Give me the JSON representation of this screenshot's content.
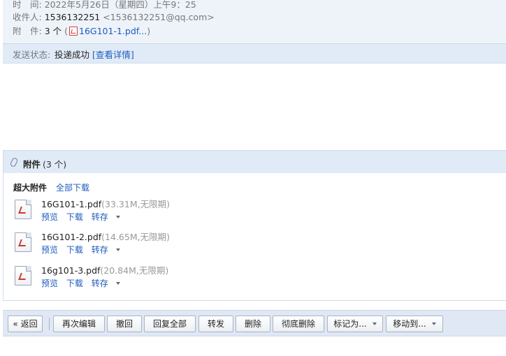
{
  "header": {
    "time_label": "时　间:",
    "time_value": "2022年5月26日（星期四）上午9：25",
    "recipient_label": "收件人:",
    "recipient_name": "1536132251",
    "recipient_email": "<1536132251@qq.com>",
    "attachment_label": "附　件:",
    "attachment_count": "3 个",
    "attachment_open": "(",
    "attachment_first": "16G101-1.pdf...",
    "attachment_close": ")"
  },
  "status": {
    "label": "发送状态:",
    "value": "投递成功",
    "detail_link": "[查看详情]"
  },
  "attachments": {
    "title": "附件",
    "count": "(3 个)",
    "super_label": "超大附件",
    "download_all": "全部下载",
    "files": [
      {
        "name": "16G101-1.pdf",
        "meta": "(33.31M,无限期)",
        "preview": "预览",
        "download": "下载",
        "save": "转存"
      },
      {
        "name": "16G101-2.pdf",
        "meta": "(14.65M,无限期)",
        "preview": "预览",
        "download": "下载",
        "save": "转存"
      },
      {
        "name": "16g101-3.pdf",
        "meta": "(20.84M,无限期)",
        "preview": "预览",
        "download": "下载",
        "save": "转存"
      }
    ]
  },
  "toolbar": {
    "back": "« 返回",
    "reedit": "再次编辑",
    "recall": "撤回",
    "reply_all": "回复全部",
    "forward": "转发",
    "delete": "删除",
    "delete_permanently": "彻底删除",
    "mark_as": "标记为...",
    "move_to": "移动到..."
  }
}
